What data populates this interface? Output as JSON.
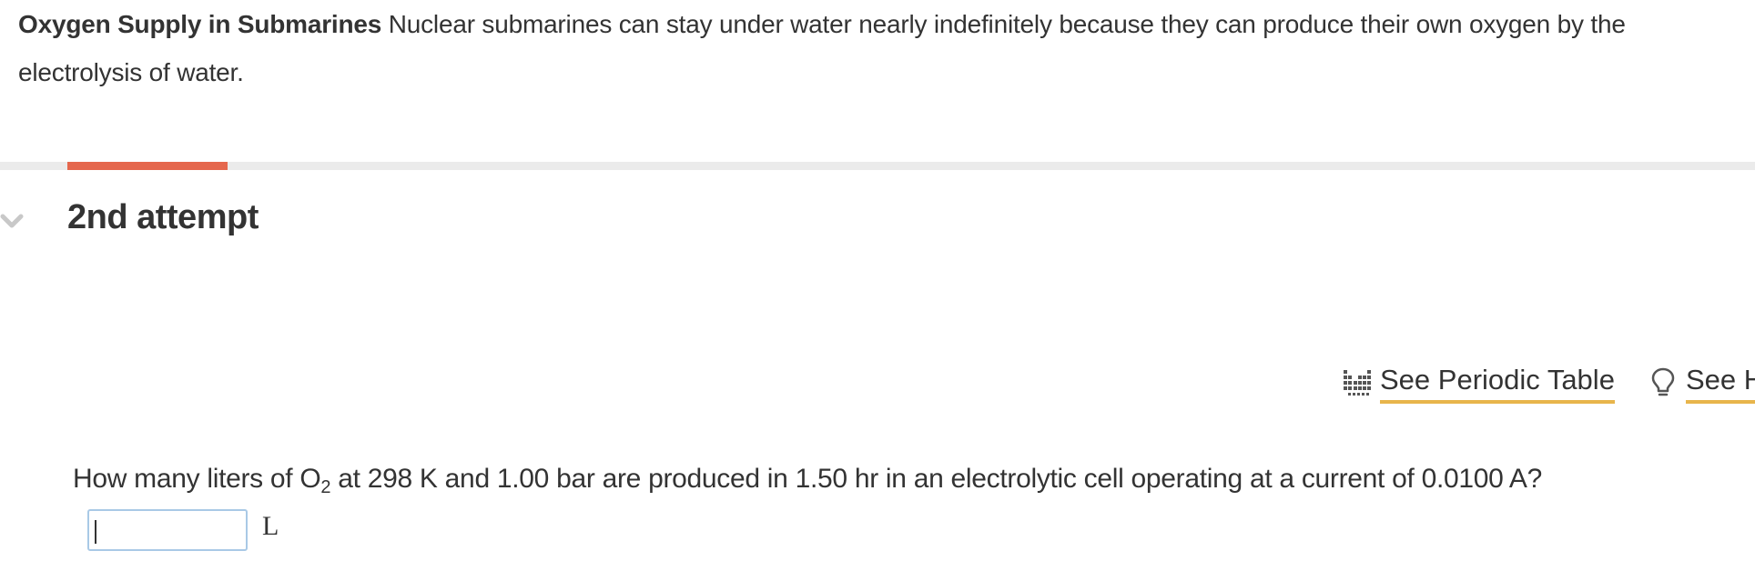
{
  "intro": {
    "title": "Oxygen Supply in Submarines",
    "text": "Nuclear submarines can stay under water nearly indefinitely because they can produce their own oxygen by the electrolysis of water."
  },
  "progress": {
    "fraction": 0.08,
    "fill_color": "#e5674d",
    "track_color": "#ebebeb"
  },
  "attempt": {
    "label": "2nd attempt",
    "icon": "chevron-down-icon"
  },
  "tools": [
    {
      "label": "See Periodic Table",
      "icon": "periodic-table-icon"
    },
    {
      "label": "See Hint",
      "icon": "lightbulb-icon"
    }
  ],
  "question": {
    "part1": "How many liters of O",
    "subscript": "2",
    "part2": " at 298 K and 1.00 bar are produced in 1.50 hr in an electrolytic cell operating at a current of 0.0100 A?"
  },
  "answer": {
    "value": "",
    "unit": "L"
  },
  "colors": {
    "accent_underline": "#e8b54b",
    "input_border": "#a9c9e6",
    "text": "#333333"
  }
}
